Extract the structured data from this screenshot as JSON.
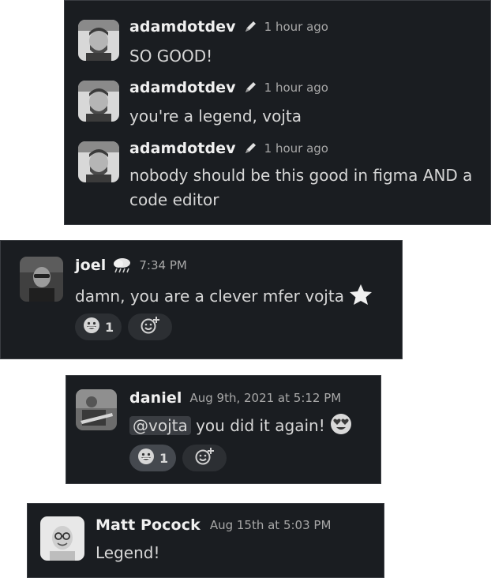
{
  "messages_group_1": [
    {
      "author": "adamdotdev",
      "badge_icon": "pencil-icon",
      "time": "1 hour ago",
      "text": "SO GOOD!"
    },
    {
      "author": "adamdotdev",
      "badge_icon": "pencil-icon",
      "time": "1 hour ago",
      "text": "you're a legend, vojta"
    },
    {
      "author": "adamdotdev",
      "badge_icon": "pencil-icon",
      "time": "1 hour ago",
      "text_line1": "nobody should be this good in figma AND a",
      "text_line2": "code editor"
    }
  ],
  "joel": {
    "author": "joel",
    "badge_icon": "rain-cloud-icon",
    "time": "7:34 PM",
    "text": "damn, you are a clever mfer vojta",
    "trailing_emoji": "star-icon",
    "reactions": [
      {
        "emoji": "grinning-face-icon",
        "count": "1"
      }
    ],
    "add_reaction_icon": "add-reaction-icon"
  },
  "daniel": {
    "author": "daniel",
    "time": "Aug 9th, 2021 at 5:12 PM",
    "mention": "@vojta",
    "text": "you did it again!",
    "trailing_emoji": "heart-eyes-icon",
    "reactions": [
      {
        "emoji": "grinning-face-icon",
        "count": "1"
      }
    ],
    "add_reaction_icon": "add-reaction-icon"
  },
  "matt": {
    "author": "Matt Pocock",
    "time": "Aug 15th at 5:03 PM",
    "text": "Legend!"
  },
  "colors": {
    "card_bg": "#1a1d21",
    "text": "#d7d7d7",
    "timestamp": "#a8a8a8",
    "name": "#f0f0f0",
    "reaction_bg": "#2c2f33"
  }
}
